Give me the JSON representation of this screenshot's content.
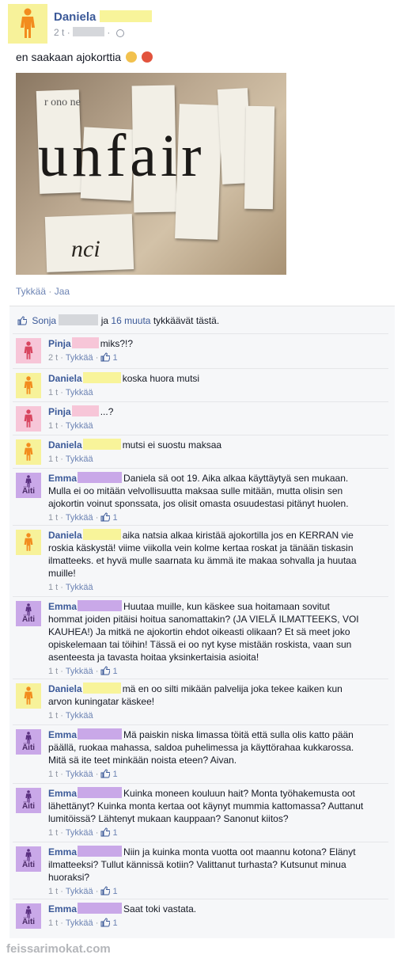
{
  "post": {
    "author": "Daniela",
    "time": "2 t",
    "text": "en saakaan ajokorttia",
    "emojis": [
      "worried-face-icon",
      "angry-face-icon"
    ],
    "photo": {
      "letters": "unfair",
      "top_text": "r ono ne",
      "bottom_text": "nci"
    }
  },
  "actions": {
    "like": "Tykkää",
    "share": "Jaa"
  },
  "likes": {
    "first": "Sonja",
    "and": "ja",
    "others": "16 muuta",
    "suffix": "tykkäävät tästä."
  },
  "comment_avatar_label": "Äiti",
  "comments": [
    {
      "author": "Pinja",
      "text": "miks?!?",
      "time": "2 t",
      "like": "Tykkää",
      "likes": "1"
    },
    {
      "author": "Daniela",
      "text": "koska huora mutsi",
      "time": "1 t",
      "like": "Tykkää",
      "likes": ""
    },
    {
      "author": "Pinja",
      "text": "...?",
      "time": "1 t",
      "like": "Tykkää",
      "likes": ""
    },
    {
      "author": "Daniela",
      "text": "mutsi ei suostu maksaa",
      "time": "1 t",
      "like": "Tykkää",
      "likes": ""
    },
    {
      "author": "Emma",
      "text": "Daniela sä oot 19. Aika alkaa käyttäytyä sen mukaan. Mulla ei oo mitään velvollisuutta maksaa sulle mitään, mutta olisin sen ajokortin voinut sponssata, jos olisit omasta osuudestasi pitänyt huolen.",
      "time": "1 t",
      "like": "Tykkää",
      "likes": "1"
    },
    {
      "author": "Daniela",
      "text": "aika natsia alkaa kiristää ajokortilla jos en KERRAN vie roskia käskystä! viime viikolla vein kolme kertaa roskat ja tänään tiskasin ilmatteeks. et hyvä mulle saarnata ku ämmä ite makaa sohvalla ja huutaa muille!",
      "time": "1 t",
      "like": "Tykkää",
      "likes": ""
    },
    {
      "author": "Emma",
      "text": "Huutaa muille, kun käskee sua hoitamaan sovitut hommat joiden pitäisi hoitua sanomattakin? (JA VIELÄ ILMATTEEKS, VOI KAUHEA!) Ja mitkä ne ajokortin ehdot oikeasti olikaan? Et sä meet joko opiskelemaan tai töihin! Tässä ei oo nyt kyse mistään roskista, vaan sun asenteesta ja tavasta hoitaa yksinkertaisia asioita!",
      "time": "1 t",
      "like": "Tykkää",
      "likes": "1"
    },
    {
      "author": "Daniela",
      "text": "mä en oo silti mikään palvelija joka tekee kaiken kun arvon kuningatar käskee!",
      "time": "1 t",
      "like": "Tykkää",
      "likes": ""
    },
    {
      "author": "Emma",
      "text": "Mä paiskin niska limassa töitä että sulla olis katto pään päällä, ruokaa mahassa, saldoa puhelimessa ja käyttörahaa kukkarossa. Mitä sä ite teet minkään noista eteen? Aivan.",
      "time": "1 t",
      "like": "Tykkää",
      "likes": "1"
    },
    {
      "author": "Emma",
      "text": "Kuinka moneen kouluun hait? Monta työhakemusta oot lähettänyt? Kuinka monta kertaa oot käynyt mummia kattomassa? Auttanut lumitöissä? Lähtenyt mukaan kauppaan? Sanonut kiitos?",
      "time": "1 t",
      "like": "Tykkää",
      "likes": "1"
    },
    {
      "author": "Emma",
      "text": "Niin ja kuinka monta vuotta oot maannu kotona? Elänyt ilmatteeksi? Tullut kännissä kotiin? Valittanut turhasta? Kutsunut minua huoraksi?",
      "time": "1 t",
      "like": "Tykkää",
      "likes": "1"
    },
    {
      "author": "Emma",
      "text": "Saat toki vastata.",
      "time": "1 t",
      "like": "Tykkää",
      "likes": "1"
    }
  ],
  "watermark": "feissarimokat.com",
  "colors": {
    "link": "#3b5998",
    "daniela": "#f7f29a",
    "pinja": "#f7c6d8",
    "emma": "#c9a8e8"
  }
}
